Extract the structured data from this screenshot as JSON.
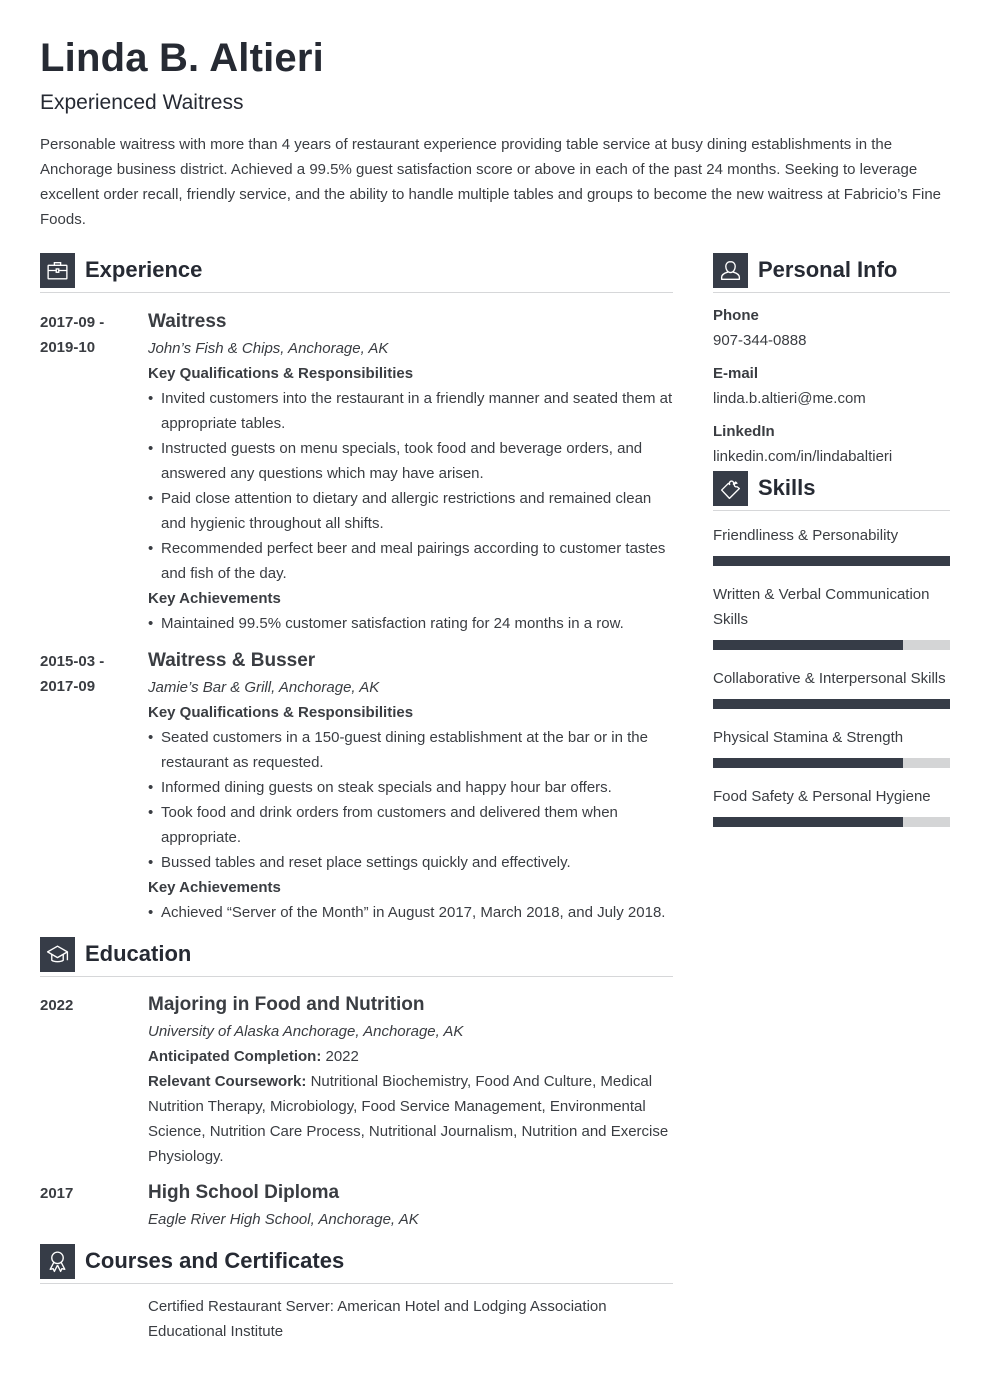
{
  "header": {
    "name": "Linda B. Altieri",
    "title": "Experienced Waitress",
    "summary": "Personable waitress with more than 4 years of restaurant experience providing table service at busy dining establishments in the Anchorage business district. Achieved a 99.5% guest satisfaction score or above in each of the past 24 months. Seeking to leverage excellent order recall, friendly service, and the ability to handle multiple tables and groups to become the new waitress at Fabricio’s Fine Foods."
  },
  "theme": {
    "accent": "#363c47",
    "bar_track": "#d4d5d6",
    "text": "#3a3d42",
    "heading": "#262a33"
  },
  "experience": {
    "heading": "Experience",
    "icon": "briefcase-icon",
    "entries": [
      {
        "date_start": "2017-09 -",
        "date_end": "2019-10",
        "role": "Waitress",
        "company": "John’s Fish & Chips, Anchorage, AK",
        "qual_heading": "Key Qualifications & Responsibilities",
        "duties": [
          "Invited customers into the restaurant in a friendly manner and seated them at appropriate tables.",
          "Instructed guests on menu specials, took food and beverage orders, and answered any questions which may have arisen.",
          "Paid close attention to dietary and allergic restrictions and remained clean and hygienic throughout all shifts.",
          "Recommended perfect beer and meal pairings according to customer tastes and fish of the day."
        ],
        "ach_heading": "Key Achievements",
        "achievements": [
          "Maintained 99.5% customer satisfaction rating for 24 months in a row."
        ]
      },
      {
        "date_start": "2015-03 -",
        "date_end": "2017-09",
        "role": "Waitress & Busser",
        "company": "Jamie’s Bar & Grill, Anchorage, AK",
        "qual_heading": "Key Qualifications & Responsibilities",
        "duties": [
          "Seated customers in a 150-guest dining establishment at the bar or in the restaurant as requested.",
          "Informed dining guests on steak specials and happy hour bar offers.",
          "Took food and drink orders from customers and delivered them when appropriate.",
          "Bussed tables and reset place settings quickly and effectively."
        ],
        "ach_heading": "Key Achievements",
        "achievements": [
          "Achieved “Server of the Month” in August 2017, March 2018, and July 2018."
        ]
      }
    ]
  },
  "education": {
    "heading": "Education",
    "icon": "graduation-cap-icon",
    "entries": [
      {
        "date": "2022",
        "degree": "Majoring in Food and Nutrition",
        "school": "University of Alaska Anchorage, Anchorage, AK",
        "completion_label": "Anticipated Completion:",
        "completion_value": "2022",
        "coursework_label": "Relevant Coursework:",
        "coursework_value": "Nutritional Biochemistry, Food And Culture, Medical Nutrition Therapy, Microbiology, Food Service Management, Environmental Science, Nutrition Care Process, Nutritional Journalism, Nutrition and Exercise Physiology."
      },
      {
        "date": "2017",
        "degree": "High School Diploma",
        "school": "Eagle River High School, Anchorage, AK"
      }
    ]
  },
  "certificates": {
    "heading": "Courses and Certificates",
    "icon": "award-ribbon-icon",
    "items": [
      "Certified Restaurant Server: American Hotel and Lodging Association Educational Institute"
    ]
  },
  "personal_info": {
    "heading": "Personal Info",
    "icon": "user-icon",
    "fields": [
      {
        "label": "Phone",
        "value": "907-344-0888"
      },
      {
        "label": "E-mail",
        "value": "linda.b.altieri@me.com"
      },
      {
        "label": "LinkedIn",
        "value": "linkedin.com/in/lindabaltieri"
      }
    ]
  },
  "skills": {
    "heading": "Skills",
    "icon": "puzzle-piece-icon",
    "items": [
      {
        "name": "Friendliness & Personability",
        "level": 100
      },
      {
        "name": "Written & Verbal Communication Skills",
        "level": 80
      },
      {
        "name": "Collaborative & Interpersonal Skills",
        "level": 100
      },
      {
        "name": "Physical Stamina & Strength",
        "level": 80
      },
      {
        "name": "Food Safety & Personal Hygiene",
        "level": 80
      }
    ]
  }
}
